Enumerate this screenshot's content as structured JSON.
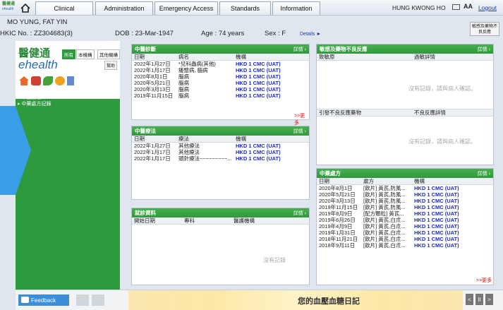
{
  "logo_small": {
    "line1": "醫健通",
    "line2": "ehealth"
  },
  "tabs": [
    "Clinical",
    "Administration",
    "Emergency Access",
    "Standards",
    "Information"
  ],
  "user": "HUNG KWONG HO",
  "font_size_label": "AA",
  "logout": "Logout",
  "patient": {
    "name": "MO YUNG, FAT YIN",
    "hkic": "HKIC No. : ZZ304683(3)",
    "dob": "DOB : 23-Mar-1947",
    "age": "Age : 74 years",
    "sex": "Sex : F",
    "details": "Details ►",
    "allergy_btn": "敏感及藥物不良反應"
  },
  "sidebar": {
    "brand1": "醫健通",
    "brand2": "ehealth",
    "filters": [
      "所有",
      "本機構",
      "其他機構"
    ],
    "help": "幫助",
    "nav": [
      "中醫診斷",
      "中醫療法",
      "中藥處方記錄"
    ]
  },
  "diagnosis": {
    "title": "中醫診斷",
    "more": "詳情",
    "headers": [
      "日期",
      "病名",
      "機構"
    ],
    "rows": [
      [
        "2022年1月27日",
        "*兒科蟲病(其他)",
        "HKD 1 CMC (UAT)"
      ],
      [
        "2022年1月17日",
        "痿躄病, 腦病",
        "HKD 1 CMC (UAT)"
      ],
      [
        "2020年8月1日",
        "腦病",
        "HKD 1 CMC (UAT)"
      ],
      [
        "2020年5月21日",
        "腦病",
        "HKD 1 CMC (UAT)"
      ],
      [
        "2020年3月13日",
        "腦病",
        "HKD 1 CMC (UAT)"
      ],
      [
        "2019年11月15日",
        "腦病",
        "HKD 1 CMC (UAT)"
      ]
    ],
    "more_link": ">>更多"
  },
  "therapy": {
    "title": "中醫療法",
    "more": "詳情",
    "headers": [
      "日期",
      "療法",
      "機構"
    ],
    "rows": [
      [
        "2022年1月27日",
        "其他療法",
        "HKD 1 CMC (UAT)"
      ],
      [
        "2022年1月17日",
        "其他療法",
        "HKD 1 CMC (UAT)"
      ],
      [
        "2022年1月17日",
        "頭針療法~~~~~~~~~...",
        "HKD 1 CMC (UAT)"
      ]
    ]
  },
  "consult": {
    "title": "就診資料",
    "more": "詳情",
    "headers": [
      "開始日期",
      "專科",
      "醫護機構"
    ],
    "empty": "沒有記錄"
  },
  "allergy": {
    "title": "敏感及藥物不良反應",
    "more": "詳情",
    "headers": [
      "致敏原",
      "過敏詳情"
    ],
    "empty": "沒有記錄，請與病人確認。",
    "headers2": [
      "引發不良反應藥物",
      "不良反應詳情"
    ],
    "empty2": "沒有記錄，請與病人確認。"
  },
  "prescription": {
    "title": "中藥處方",
    "more": "詳情",
    "headers": [
      "日期",
      "處方",
      "機構"
    ],
    "rows": [
      [
        "2020年8月1日",
        "[飲片] 黃芪,防風...",
        "HKD 1 CMC (UAT)"
      ],
      [
        "2020年5月21日",
        "[飲片] 黃芪,防風...",
        "HKD 1 CMC (UAT)"
      ],
      [
        "2020年3月13日",
        "[飲片] 黃芪,防風...",
        "HKD 1 CMC (UAT)"
      ],
      [
        "2019年11月15日",
        "[飲片] 黃芪,防風...",
        "HKD 1 CMC (UAT)"
      ],
      [
        "2019年8月9日",
        "[配方顆粒] 黃芪...",
        "HKD 1 CMC (UAT)"
      ],
      [
        "2019年6月26日",
        "[飲片] 黃芪,白朮...",
        "HKD 1 CMC (UAT)"
      ],
      [
        "2019年4月9日",
        "[飲片] 黃芪,白朮...",
        "HKD 1 CMC (UAT)"
      ],
      [
        "2019年1月31日",
        "[飲片] 黃芪,白朮...",
        "HKD 1 CMC (UAT)"
      ],
      [
        "2018年11月21日",
        "[飲片] 黃芪,白朮...",
        "HKD 1 CMC (UAT)"
      ],
      [
        "2018年9月11日",
        "[飲片] 黃芪,白朮...",
        "HKD 1 CMC (UAT)"
      ]
    ],
    "more_link": ">>更多"
  },
  "bottom": {
    "feedback": "Feedback",
    "banner_text": "您的血壓血糖日記",
    "pager": [
      "<",
      "II",
      ">"
    ]
  }
}
